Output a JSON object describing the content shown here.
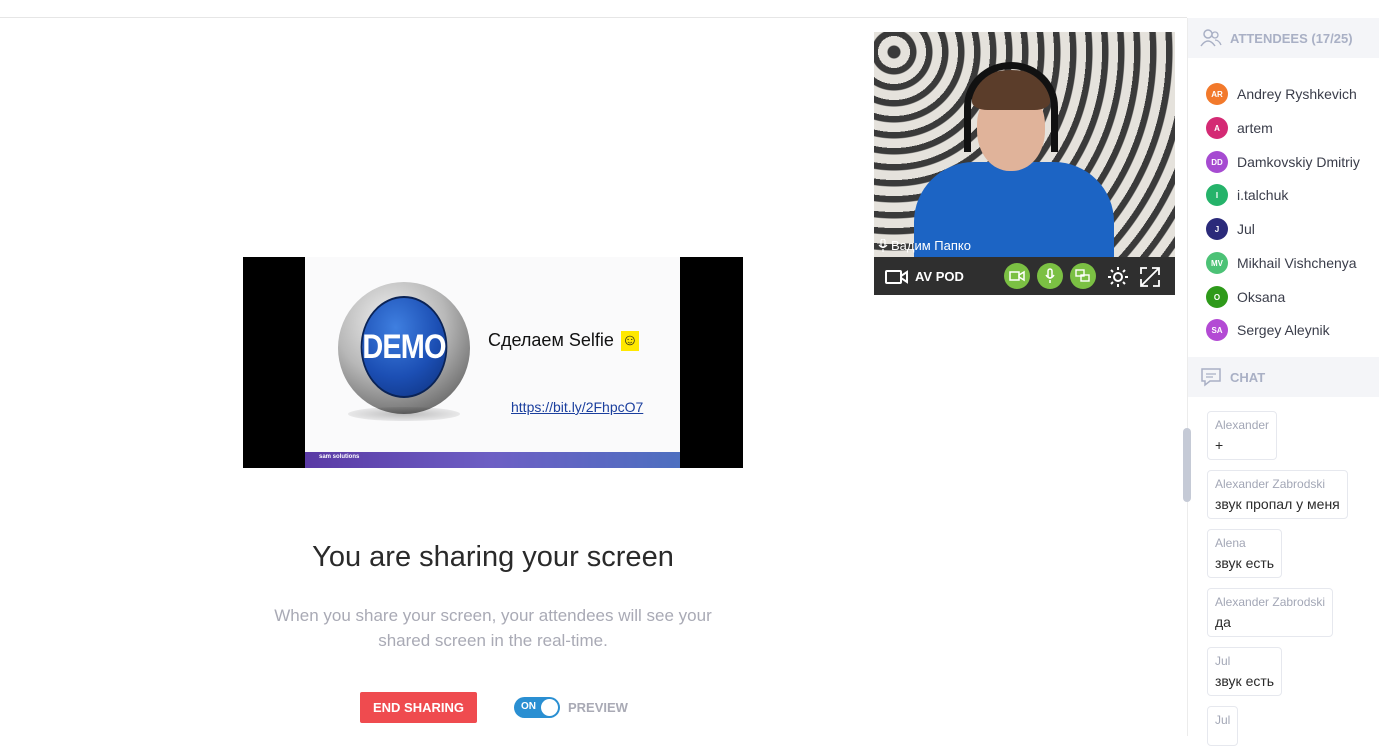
{
  "share": {
    "title": "You are sharing your screen",
    "subtitle_line1": "When you share your screen, your attendees will see your",
    "subtitle_line2": "shared screen in the real-time.",
    "end_button": "END SHARING",
    "toggle_state": "ON",
    "preview_label": "PREVIEW"
  },
  "slide": {
    "badge": "DEMO",
    "heading": "Сделаем Selfie",
    "emoji": "☺",
    "link": "https://bit.ly/2FhpcO7",
    "footer_brand": "sam solutions"
  },
  "webcam": {
    "speaker_name": "Вадим Папко",
    "source_label": "AV POD"
  },
  "attendees": {
    "header": "ATTENDEES (17/25)",
    "list": [
      {
        "initials": "AR",
        "name": "Andrey Ryshkevich",
        "color": "#f2792b"
      },
      {
        "initials": "A",
        "name": "artem",
        "color": "#d42a74"
      },
      {
        "initials": "DD",
        "name": "Damkovskiy Dmitriy",
        "color": "#a64bd1"
      },
      {
        "initials": "I",
        "name": "i.talchuk",
        "color": "#25b36a"
      },
      {
        "initials": "J",
        "name": "Jul",
        "color": "#2b2a7a"
      },
      {
        "initials": "MV",
        "name": "Mikhail Vishchenya",
        "color": "#4cc276"
      },
      {
        "initials": "O",
        "name": "Oksana",
        "color": "#2e9a1a"
      },
      {
        "initials": "SA",
        "name": "Sergey Aleynik",
        "color": "#b34ad4"
      }
    ]
  },
  "chat": {
    "header": "CHAT",
    "messages": [
      {
        "author": "Alexander",
        "text": "+"
      },
      {
        "author": "Alexander Zabrodski",
        "text": "звук пропал у меня"
      },
      {
        "author": "Alena",
        "text": "звук есть"
      },
      {
        "author": "Alexander Zabrodski",
        "text": "да"
      },
      {
        "author": "Jul",
        "text": "звук есть"
      },
      {
        "author": "Jul",
        "text": ""
      }
    ]
  },
  "colors": {
    "accent_red": "#ef4b4f",
    "toggle_blue": "#2a8fd2",
    "cam_green": "#7bc043",
    "sidebar_header_bg": "#f4f5f8"
  }
}
